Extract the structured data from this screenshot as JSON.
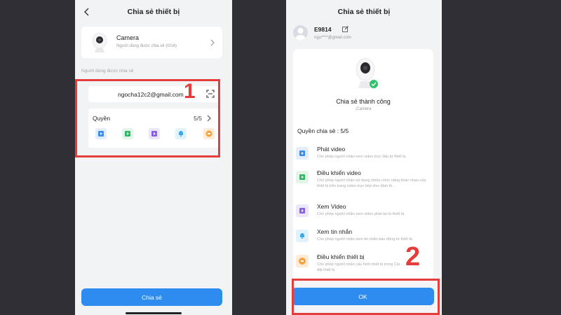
{
  "screen1": {
    "title": "Chia sẻ thiết bị",
    "device": {
      "name": "Camera",
      "subtitle": "Người dùng được chia sẻ (0/16)"
    },
    "section_label": "Người dùng được chia sẻ",
    "email": "ngocha12c2@gmail.com",
    "permissions": {
      "label": "Quyền",
      "count": "5/5",
      "icons": [
        "play-video-icon",
        "control-video-icon",
        "view-video-icon",
        "message-bell-icon",
        "device-control-icon"
      ]
    },
    "share_button": "Chia sẻ",
    "step_number": "1"
  },
  "screen2": {
    "title": "Chia sẻ thiết bị",
    "user": {
      "name": "E9814",
      "email": "ngu****@gmail.com"
    },
    "success_title": "Chia sẻ thành công",
    "success_subtitle": ".Camera",
    "permissions_heading": "Quyền chia sẻ : 5/5",
    "permissions": [
      {
        "title": "Phát video",
        "desc": "Cho phép người nhận xem video trực tiếp từ thiết bị.",
        "icon": "play-video-icon"
      },
      {
        "title": "Điều khiển video",
        "desc": "Cho phép người nhận sử dụng nhiều chức năng khác nhau của thiết bị trên trang video trực tiếp như đàm th...",
        "icon": "control-video-icon"
      },
      {
        "title": "Xem Video",
        "desc": "Cho phép người nhận xem video phát lại từ thiết bị.",
        "icon": "view-video-icon"
      },
      {
        "title": "Xem tin nhắn",
        "desc": "Cho phép người nhận xem tin nhắn báo động từ thiết bị.",
        "icon": "message-bell-icon"
      },
      {
        "title": "Điều khiển thiết bị",
        "desc": "Cho phép người nhận cấu hình thiết bị trong Cài đặt thiết bị",
        "icon": "device-control-icon"
      }
    ],
    "ok_button": "OK",
    "step_number": "2"
  },
  "colors": {
    "accent": "#2e8bf0",
    "annotation": "#e43d3b",
    "success": "#2fc26b"
  }
}
